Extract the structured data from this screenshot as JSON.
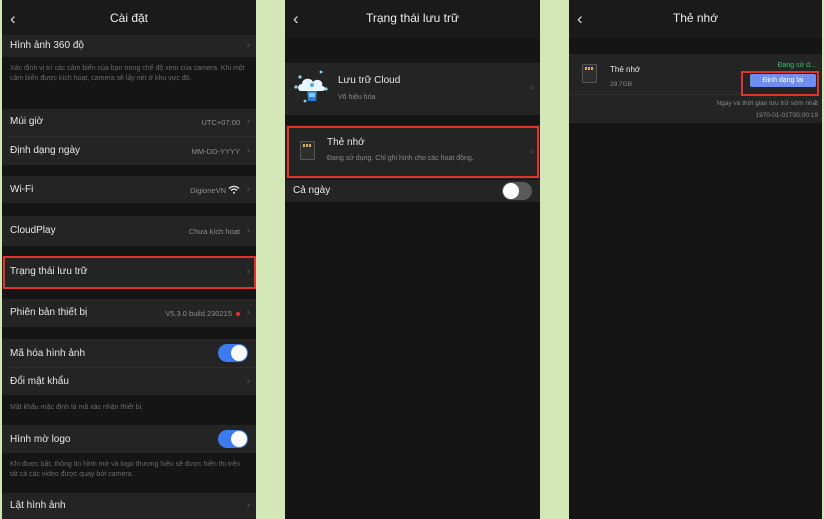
{
  "panel1": {
    "title": "Cài đặt",
    "rows": {
      "img360": "Hình ảnh 360 độ",
      "img360_note": "Xác định vị trí các cảm biến của bạn trong chế độ xem của camera. Khi một cảm biến được kích hoạt, camera sẽ lấy nét ở khu vực đó.",
      "timezone": "Múi giờ",
      "timezone_value": "UTC+07:00",
      "date_format": "Định dạng ngày",
      "date_format_value": "MM-DD-YYYY",
      "wifi": "Wi-Fi",
      "wifi_value": "DigioneVN",
      "cloudplay": "CloudPlay",
      "cloudplay_value": "Chưa kích hoạt",
      "storage": "Trạng thái lưu trữ",
      "firmware": "Phiên bản thiết bị",
      "firmware_value": "V5.3.0 build 230215",
      "encrypt": "Mã hóa hình ảnh",
      "change_pw": "Đổi mật khẩu",
      "pw_note": "Mật khẩu mặc định là mã xác nhận thiết bị.",
      "logo": "Hình mờ logo",
      "logo_note": "Khi được bật, thông tin hình mờ và logo thương hiệu sẽ được hiển thị trên tất cả các video được quay bởi camera.",
      "flip": "Lật hình ảnh"
    },
    "encrypt_on": true,
    "logo_on": true
  },
  "panel2": {
    "title": "Trạng thái lưu trữ",
    "cloud_label": "Lưu trữ Cloud",
    "cloud_sub": "Vô hiệu hóa",
    "sd_label": "Thẻ nhớ",
    "sd_sub": "Đang sử dụng. Chỉ ghi hình cho các hoạt động.",
    "allday": "Cả ngày",
    "allday_on": false
  },
  "panel3": {
    "title": "Thẻ nhớ",
    "card_name": "Thẻ nhớ",
    "card_size": "29.7GB",
    "status": "Đang sử d...",
    "format_btn": "Định dạng lại",
    "earliest_label": "Ngày và thời gian lưu trữ sớm nhất",
    "earliest_value": "1970-01-01T00:00:19"
  },
  "colors": {
    "accent": "#3d7bf0",
    "highlight": "#e0342b",
    "status_green": "#3fbf6b",
    "button": "#6f8ff0"
  }
}
